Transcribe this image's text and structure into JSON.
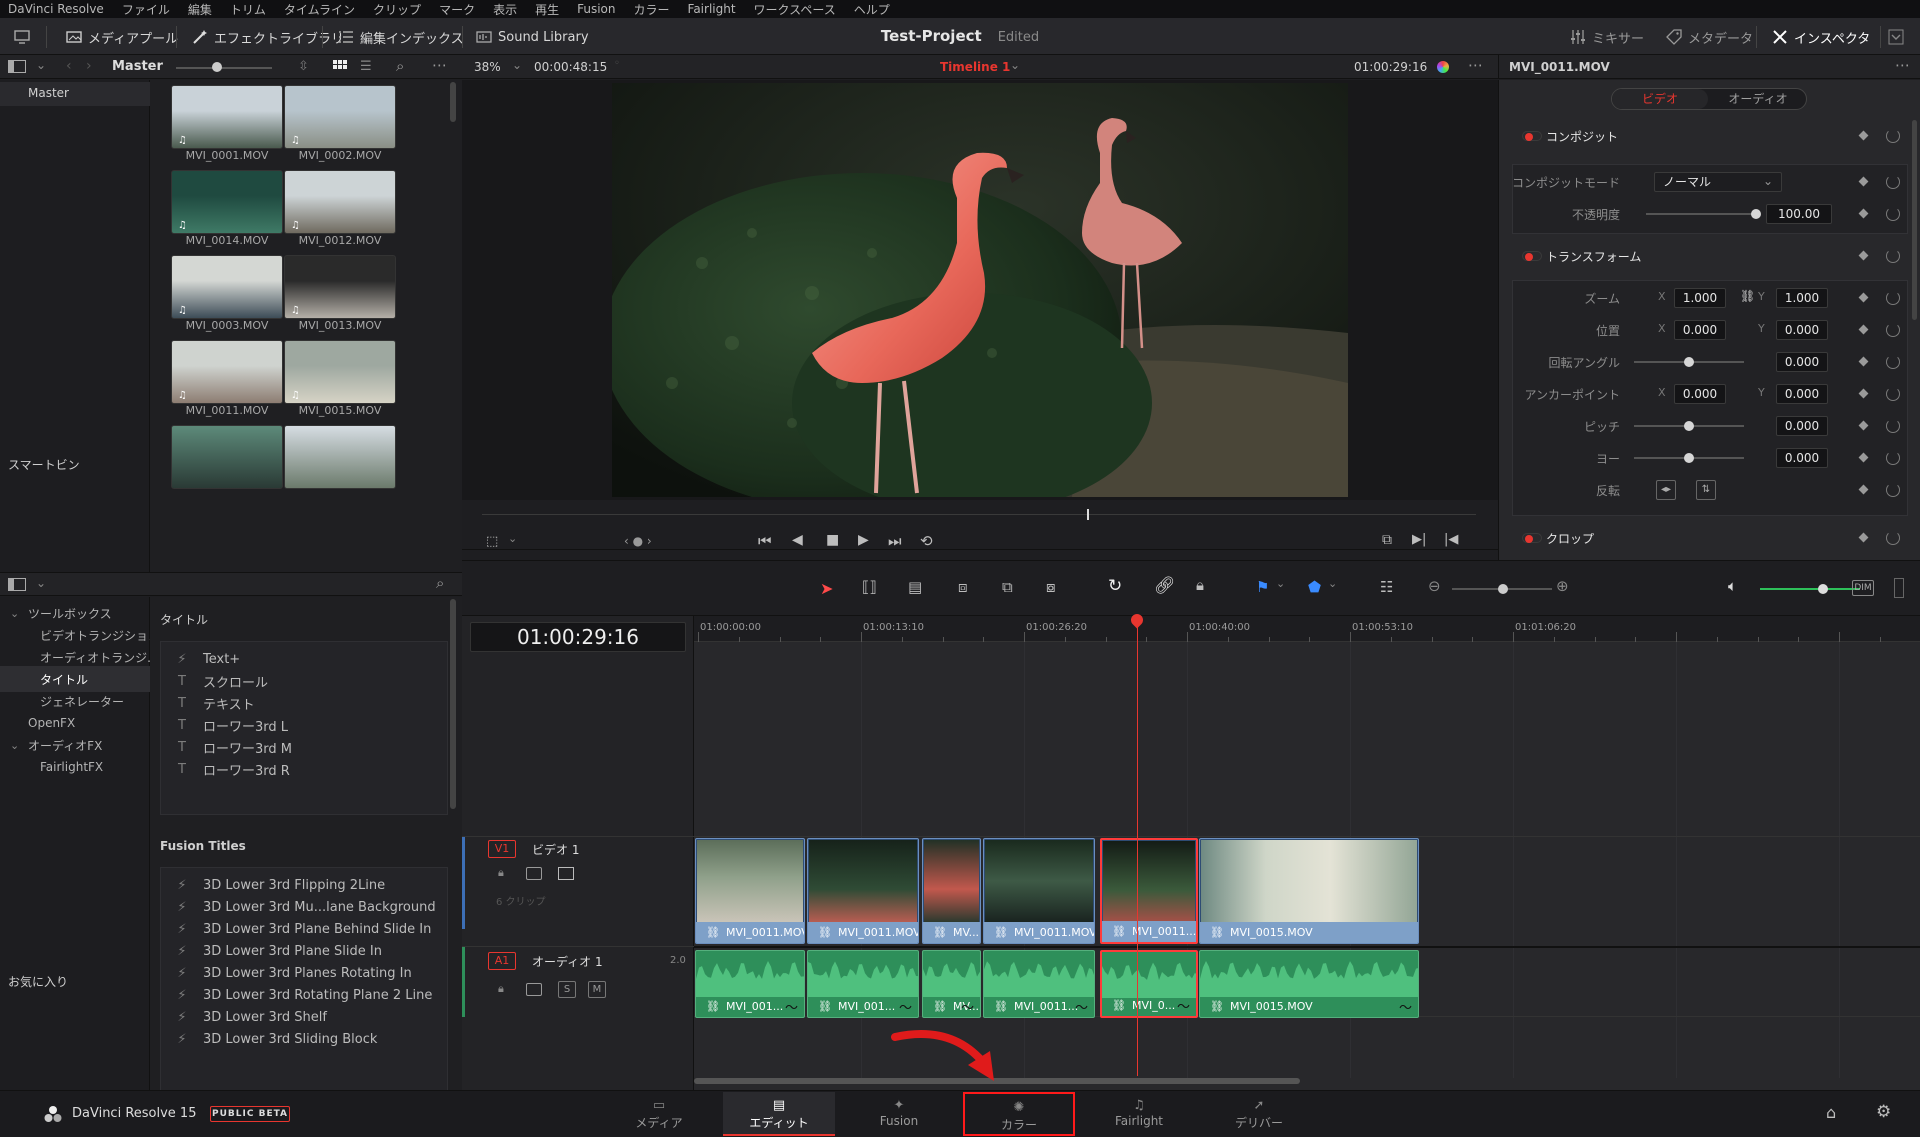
{
  "menu": [
    "DaVinci Resolve",
    "ファイル",
    "編集",
    "トリム",
    "タイムライン",
    "クリップ",
    "マーク",
    "表示",
    "再生",
    "Fusion",
    "カラー",
    "Fairlight",
    "ワークスペース",
    "ヘルプ"
  ],
  "toolbar": {
    "media_pool": "メディアプール",
    "effects_library": "エフェクトライブラリ",
    "edit_index": "編集インデックス",
    "sound_library": "Sound Library",
    "mixer": "ミキサー",
    "metadata": "メタデータ",
    "inspector": "インスペクタ"
  },
  "project": {
    "title": "Test-Project",
    "status": "Edited"
  },
  "media_pool": {
    "bin_label": "Master",
    "tree_master": "Master",
    "smart_bins": "スマートビン",
    "clips": [
      "MVI_0001.MOV",
      "MVI_0002.MOV",
      "MVI_0014.MOV",
      "MVI_0012.MOV",
      "MVI_0003.MOV",
      "MVI_0013.MOV",
      "MVI_0011.MOV",
      "MVI_0015.MOV"
    ]
  },
  "viewer": {
    "zoom": "38%",
    "source_tc": "00:00:48:15",
    "timeline_name": "Timeline 1",
    "record_tc": "01:00:29:16"
  },
  "effects": {
    "tree": [
      {
        "label": "ツールボックス",
        "indent": 0,
        "arrow": true
      },
      {
        "label": "ビデオトランジション",
        "indent": 1
      },
      {
        "label": "オーディオトランジ...",
        "indent": 1
      },
      {
        "label": "タイトル",
        "indent": 1,
        "selected": true
      },
      {
        "label": "ジェネレーター",
        "indent": 1
      },
      {
        "label": "OpenFX",
        "indent": 0
      },
      {
        "label": "オーディオFX",
        "indent": 0,
        "arrow": true
      },
      {
        "label": "FairlightFX",
        "indent": 1
      }
    ],
    "favorites": "お気に入り",
    "titles_header": "タイトル",
    "titles": [
      {
        "icon": "lightning",
        "label": "Text+"
      },
      {
        "icon": "T",
        "label": "スクロール"
      },
      {
        "icon": "T",
        "label": "テキスト"
      },
      {
        "icon": "T",
        "label": "ローワー3rd L"
      },
      {
        "icon": "T",
        "label": "ローワー3rd M"
      },
      {
        "icon": "T",
        "label": "ローワー3rd R"
      }
    ],
    "fusion_header": "Fusion Titles",
    "fusion_titles": [
      "3D Lower 3rd Flipping 2Line",
      "3D Lower 3rd Mu...lane Background",
      "3D Lower 3rd Plane Behind Slide In",
      "3D Lower 3rd Plane Slide In",
      "3D Lower 3rd Planes Rotating In",
      "3D Lower 3rd Rotating Plane 2 Line",
      "3D Lower 3rd Shelf",
      "3D Lower 3rd Sliding Block"
    ]
  },
  "inspector": {
    "clip": "MVI_0011.MOV",
    "tab_video": "ビデオ",
    "tab_audio": "オーディオ",
    "composite": "コンポジット",
    "composite_mode_label": "コンポジットモード",
    "composite_mode": "ノーマル",
    "opacity_label": "不透明度",
    "opacity": "100.00",
    "transform": "トランスフォーム",
    "zoom_label": "ズーム",
    "zoom_x": "1.000",
    "zoom_y": "1.000",
    "position_label": "位置",
    "pos_x": "0.000",
    "pos_y": "0.000",
    "rotation_label": "回転アングル",
    "rotation": "0.000",
    "anchor_label": "アンカーポイント",
    "anchor_x": "0.000",
    "anchor_y": "0.000",
    "pitch_label": "ピッチ",
    "pitch": "0.000",
    "yaw_label": "ヨー",
    "yaw": "0.000",
    "flip_label": "反転",
    "crop": "クロップ",
    "x": "X",
    "y": "Y"
  },
  "timeline": {
    "timecode": "01:00:29:16",
    "ruler": [
      "01:00:00:00",
      "01:00:13:10",
      "01:00:26:20",
      "01:00:40:00",
      "01:00:53:10",
      "01:01:06:20"
    ],
    "v1_tag": "V1",
    "v1_name": "ビデオ 1",
    "v1_count": "6 クリップ",
    "a1_tag": "A1",
    "a1_name": "オーディオ 1",
    "a1_ch": "2.0",
    "audio_s": "S",
    "audio_m": "M",
    "dim": "DIM",
    "video_clips": [
      "MVI_0011.MOV",
      "MVI_0011.MOV",
      "MV...",
      "MVI_0011.MOV",
      "MVI_0011....",
      "MVI_0015.MOV"
    ],
    "audio_clips": [
      "MVI_001...",
      "MVI_001...",
      "MV...",
      "MVI_0011...",
      "MVI_0...",
      "MVI_0015.MOV"
    ]
  },
  "bottom": {
    "app": "DaVinci Resolve 15",
    "beta": "PUBLIC BETA",
    "pages": [
      "メディア",
      "エディット",
      "Fusion",
      "カラー",
      "Fairlight",
      "デリバー"
    ]
  },
  "colors": {
    "accent_red": "#e8362f",
    "timeline_blue": "#7ea0c8",
    "audio_green": "#2e8f5a",
    "page_highlight": "#ff1a1a"
  }
}
